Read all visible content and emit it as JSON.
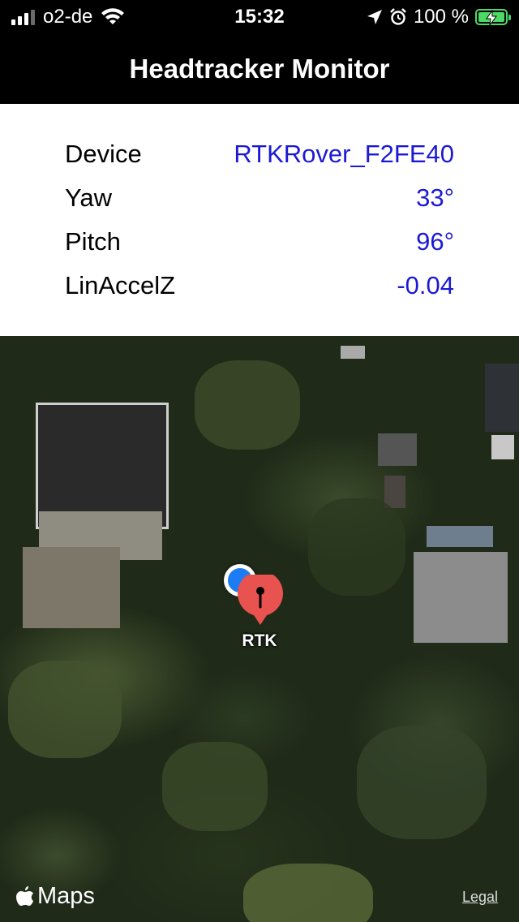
{
  "status_bar": {
    "carrier": "o2-de",
    "time": "15:32",
    "battery_percent": "100 %",
    "signal_bars": 3,
    "icons": [
      "signal-icon",
      "wifi-icon",
      "location-arrow-icon",
      "alarm-icon",
      "battery-charging-icon"
    ]
  },
  "navbar": {
    "title": "Headtracker Monitor"
  },
  "info": {
    "rows": [
      {
        "label": "Device",
        "value": "RTKRover_F2FE40"
      },
      {
        "label": "Yaw",
        "value": "33°"
      },
      {
        "label": "Pitch",
        "value": "96°"
      },
      {
        "label": "LinAccelZ",
        "value": "-0.04"
      }
    ],
    "value_color": "#1c19d4"
  },
  "map": {
    "pin_label": "RTK",
    "attribution": "Maps",
    "legal_label": "Legal",
    "pin_color": "#e8524f",
    "location_dot_color": "#1c7cf4"
  }
}
